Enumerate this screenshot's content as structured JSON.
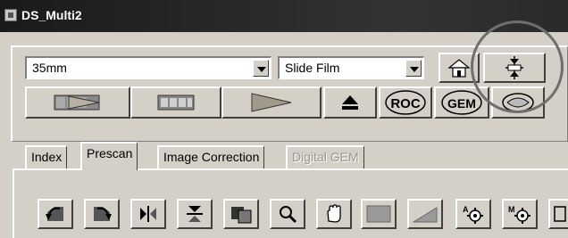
{
  "window": {
    "title": "DS_Multi2"
  },
  "film_format": {
    "selected": "35mm"
  },
  "film_type": {
    "selected": "Slide Film"
  },
  "toolbar": {
    "roc_label": "ROC",
    "gem_label": "GEM"
  },
  "tabs": [
    {
      "label": "Index",
      "state": "normal"
    },
    {
      "label": "Prescan",
      "state": "active"
    },
    {
      "label": "Image Correction",
      "state": "normal"
    },
    {
      "label": "Digital GEM",
      "state": "disabled"
    }
  ],
  "icons": {
    "scan_all": "scan-all-icon",
    "film_strip": "film-strip-icon",
    "scan": "scan-icon",
    "eject": "eject-icon",
    "home": "home-icon",
    "autofocus": "autofocus-icon",
    "rotate_left": "rotate-left-icon",
    "rotate_right": "rotate-right-icon",
    "flip_horizontal": "flip-horizontal-icon",
    "flip_vertical": "flip-vertical-icon",
    "crop": "crop-icon",
    "zoom": "zoom-icon",
    "hand": "hand-icon",
    "undo": "undo-icon",
    "color_balance": "color-balance-icon",
    "curve": "curve-icon",
    "auto_settings": "auto-settings-icon",
    "manual_settings": "manual-settings-icon"
  },
  "colors": {
    "face": "#d4d0c8",
    "titlebar": "#1a1a1a",
    "highlight_circle": "#6e6e6e"
  }
}
